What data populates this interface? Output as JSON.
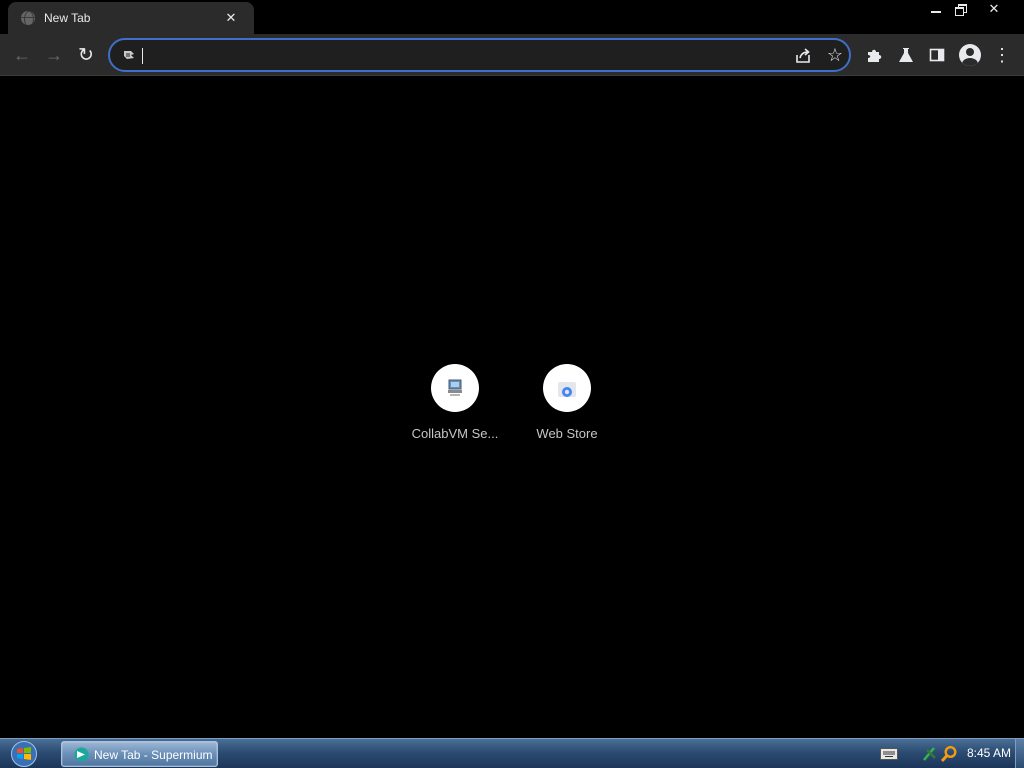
{
  "browser": {
    "tab": {
      "title": "New Tab",
      "close_icon": "close-icon"
    },
    "window_controls": {
      "minimize_icon": "minimize-icon",
      "restore_icon": "restore-icon",
      "close_glyph": "✕"
    },
    "toolbar": {
      "back_glyph": "←",
      "forward_glyph": "→",
      "reload_glyph": "↻",
      "star_glyph": "☆",
      "menu_glyph": "⋮"
    },
    "omnibox": {
      "value": "",
      "placeholder": ""
    },
    "shortcuts": [
      {
        "label": "CollabVM Se...",
        "icon": "collabvm-icon"
      },
      {
        "label": "Web Store",
        "icon": "web-store-icon"
      }
    ],
    "colors": {
      "toolbar_bg": "#2b2b2b",
      "omnibox_focus": "#3f6fc6",
      "page_bg": "#000000"
    }
  },
  "taskbar": {
    "item_label": "New Tab - Supermium",
    "clock": "8:45 AM"
  }
}
